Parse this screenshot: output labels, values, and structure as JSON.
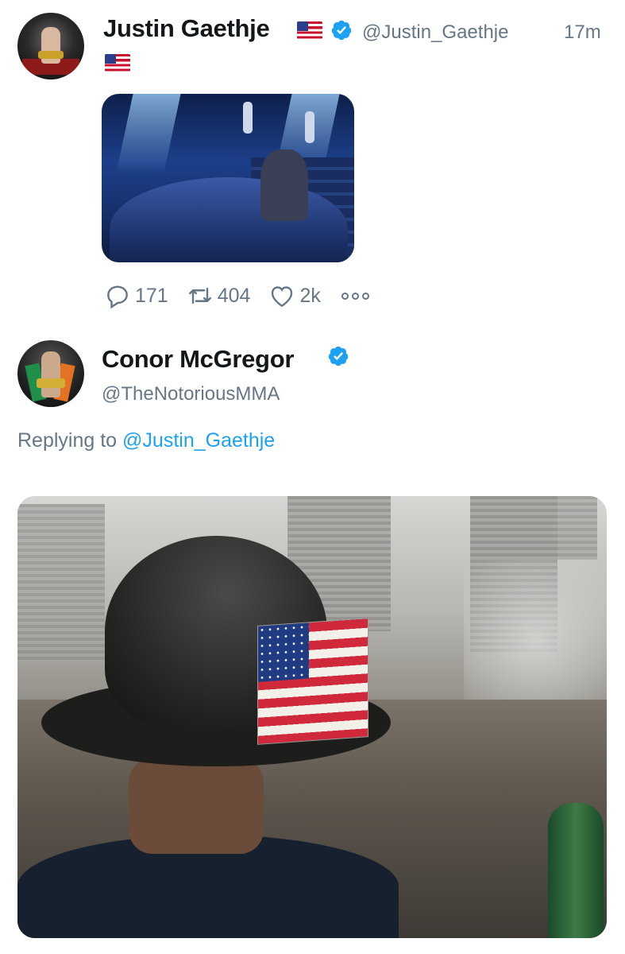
{
  "tweets": [
    {
      "author": {
        "name": "Justin Gaethje",
        "handle": "@Justin_Gaethje",
        "verified": true,
        "name_emoji": "us-flag",
        "bio_emoji": "us-flag"
      },
      "time": "17m",
      "media": {
        "description_icon": "image"
      },
      "actions": {
        "replies": "171",
        "retweets": "404",
        "likes": "2k"
      }
    },
    {
      "author": {
        "name": "Conor McGregor",
        "handle": "@TheNotoriousMMA",
        "verified": true
      },
      "replying_to": {
        "prefix": "Replying to",
        "handle": "@Justin_Gaethje"
      },
      "media": {
        "description_icon": "image"
      }
    }
  ],
  "colors": {
    "verified": "#1da1f2",
    "link": "#1da1f2",
    "secondary_text": "#657786",
    "primary_text": "#14171a"
  },
  "icons": [
    "reply-icon",
    "retweet-icon",
    "like-icon",
    "more-icon",
    "verified-badge-icon",
    "us-flag-icon"
  ]
}
